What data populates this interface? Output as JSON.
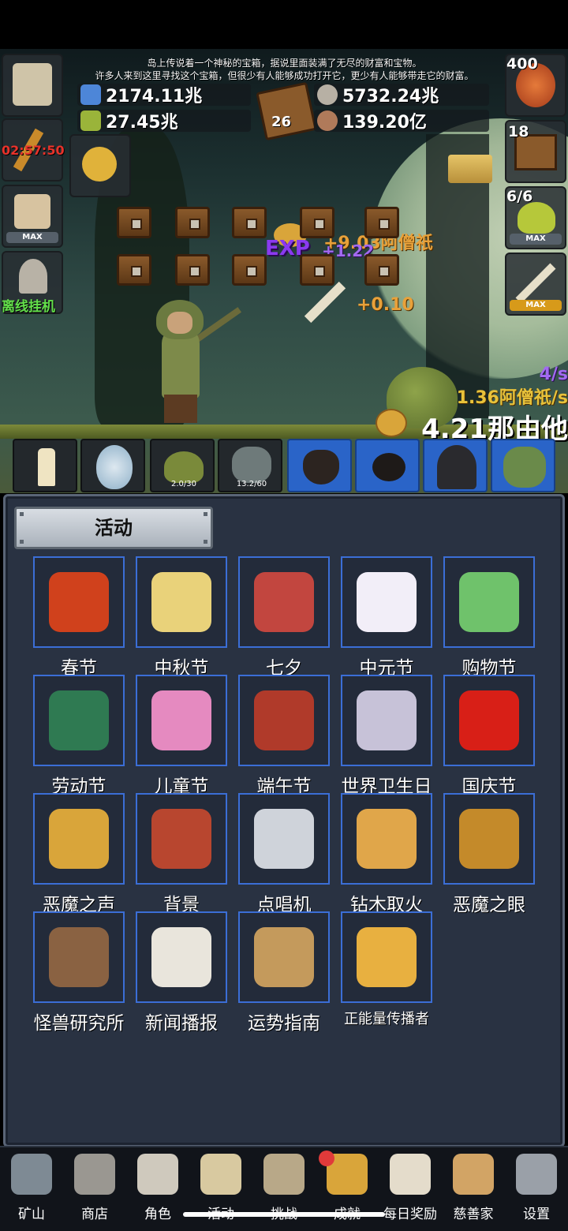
{
  "header": {
    "legend_line1": "岛上传说着一个神秘的宝箱，据说里面装满了无尽的财富和宝物。",
    "legend_line2": "许多人来到这里寻找这个宝箱，但很少有人能够成功打开它，更少有人能够带走它的财富。"
  },
  "resources": {
    "blue_potion": "2174.11兆",
    "green_potion": "27.45兆",
    "book_level": "26",
    "coin": "5732.24兆",
    "meat": "139.20亿"
  },
  "left_slots": {
    "timer": "02:57:50",
    "max1": "MAX",
    "offline_label": "离线挂机"
  },
  "right_slots": {
    "potion_count": "400",
    "chest_count": "18",
    "slime_count": "6/6",
    "max1": "MAX",
    "max2": "MAX"
  },
  "floating": {
    "exp_label": "EXP",
    "gain1": "+9.03阿僧祇",
    "gain2": "+1.22",
    "gain3": "+0.10"
  },
  "stats": {
    "rate": "4/s",
    "income": "1.36阿僧祇/s",
    "total": "4.21那由他"
  },
  "units": {
    "slime_progress": "2.0/30",
    "zombie_progress": "13.2/60"
  },
  "panel": {
    "tab_label": "活动",
    "events": [
      {
        "label": "春节",
        "icon": "red-lantern-icon",
        "color": "#d0411c"
      },
      {
        "label": "中秋节",
        "icon": "full-moon-icon",
        "color": "#e9d27a"
      },
      {
        "label": "七夕",
        "icon": "heart-icon",
        "color": "#c2463f"
      },
      {
        "label": "中元节",
        "icon": "ghost-icon",
        "color": "#f2eef8"
      },
      {
        "label": "购物节",
        "icon": "cash-icon",
        "color": "#6fc26b"
      },
      {
        "label": "劳动节",
        "icon": "brush-icon",
        "color": "#2f7a52"
      },
      {
        "label": "儿童节",
        "icon": "lollipop-icon",
        "color": "#e58ac0"
      },
      {
        "label": "端午节",
        "icon": "dragon-mask-icon",
        "color": "#b03a2a"
      },
      {
        "label": "世界卫生日",
        "icon": "ambulance-icon",
        "color": "#c7c2d8"
      },
      {
        "label": "国庆节",
        "icon": "china-flag-icon",
        "color": "#d81f17"
      },
      {
        "label": "恶魔之声",
        "icon": "demon-bell-icon",
        "color": "#d9a53a"
      },
      {
        "label": "背景",
        "icon": "sunset-icon",
        "color": "#b8462f"
      },
      {
        "label": "点唱机",
        "icon": "cassette-icon",
        "color": "#cfd3da"
      },
      {
        "label": "钻木取火",
        "icon": "torch-stick-icon",
        "color": "#e0a64a"
      },
      {
        "label": "恶魔之眼",
        "icon": "demon-eye-icon",
        "color": "#c48a2a"
      },
      {
        "label": "怪兽研究所",
        "icon": "research-lab-icon",
        "color": "#8a6242"
      },
      {
        "label": "新闻播报",
        "icon": "newspaper-icon",
        "color": "#e9e5dc"
      },
      {
        "label": "运势指南",
        "icon": "fortune-map-icon",
        "color": "#c49a5c"
      },
      {
        "label": "正能量传播者",
        "icon": "crown-icon",
        "color": "#e8b040"
      }
    ]
  },
  "nav": [
    {
      "label": "矿山",
      "icon": "lantern-icon",
      "color": "#7e8a94"
    },
    {
      "label": "商店",
      "icon": "ore-icon",
      "color": "#9a9791"
    },
    {
      "label": "角色",
      "icon": "skull-icon",
      "color": "#cfc9bd"
    },
    {
      "label": "活动",
      "icon": "scroll-icon",
      "color": "#d8c9a0"
    },
    {
      "label": "挑战",
      "icon": "map-icon",
      "color": "#b8a888"
    },
    {
      "label": "成就",
      "icon": "key-icon",
      "color": "#d9a53a"
    },
    {
      "label": "每日奖励",
      "icon": "envelope-icon",
      "color": "#e4dccb"
    },
    {
      "label": "慈善家",
      "icon": "bread-icon",
      "color": "#d2a465"
    },
    {
      "label": "设置",
      "icon": "gear-icon",
      "color": "#9aa0a8"
    }
  ]
}
